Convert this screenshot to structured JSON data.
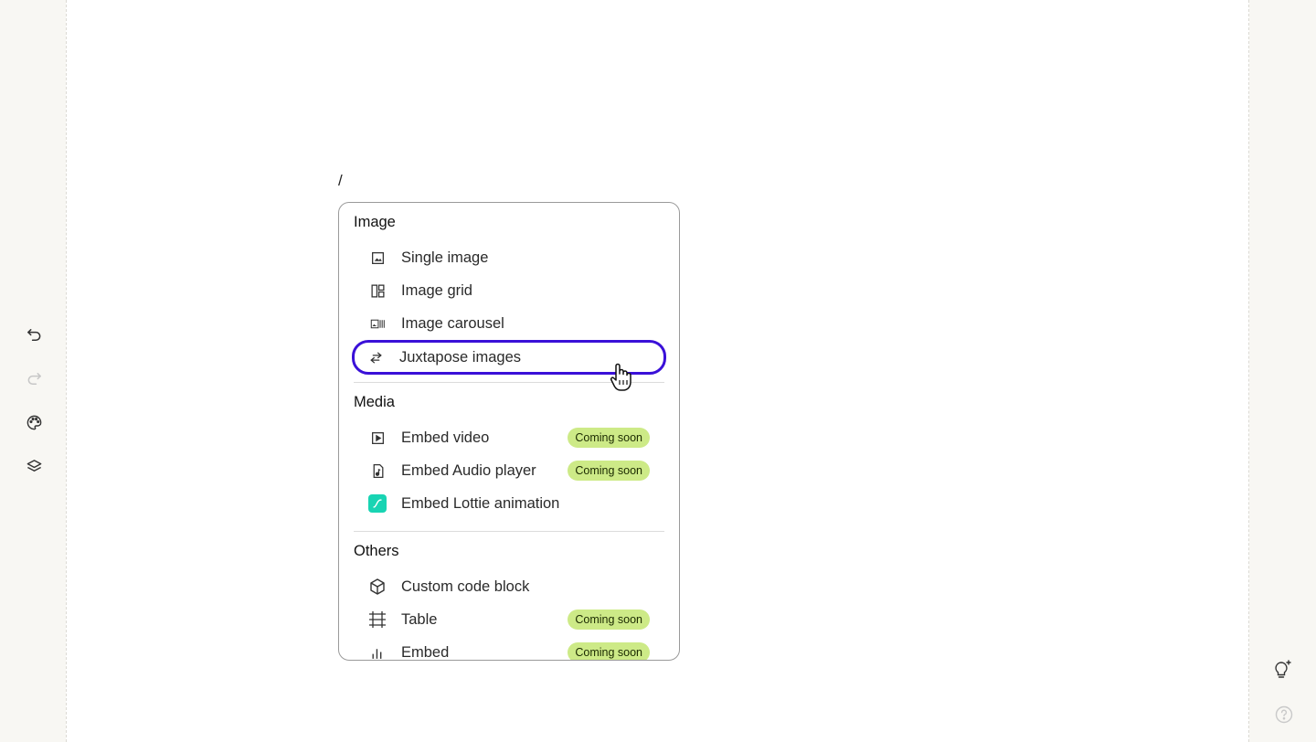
{
  "slash_text": "/",
  "toolbar": {
    "undo": "undo-icon",
    "redo": "redo-icon",
    "theme": "palette-icon",
    "layers": "layers-icon"
  },
  "menu": {
    "sections": [
      {
        "title": "Image",
        "items": [
          {
            "label": "Single image",
            "icon": "single-image-icon"
          },
          {
            "label": "Image grid",
            "icon": "image-grid-icon"
          },
          {
            "label": "Image carousel",
            "icon": "image-carousel-icon"
          },
          {
            "label": "Juxtapose images",
            "icon": "juxtapose-icon"
          }
        ]
      },
      {
        "title": "Media",
        "items": [
          {
            "label": "Embed video",
            "icon": "video-icon",
            "badge": "Coming soon"
          },
          {
            "label": "Embed Audio player",
            "icon": "audio-icon",
            "badge": "Coming soon"
          },
          {
            "label": "Embed Lottie animation",
            "icon": "lottie-icon"
          }
        ]
      },
      {
        "title": "Others",
        "items": [
          {
            "label": "Custom code block",
            "icon": "cube-icon"
          },
          {
            "label": "Table",
            "icon": "table-icon",
            "badge": "Coming soon"
          },
          {
            "label": "Embed",
            "icon": "chart-icon",
            "badge": "Coming soon"
          }
        ]
      }
    ]
  },
  "colors": {
    "accent_outline": "#3a10d8",
    "badge_bg": "#cdea87",
    "lottie": "#18d4b3"
  }
}
